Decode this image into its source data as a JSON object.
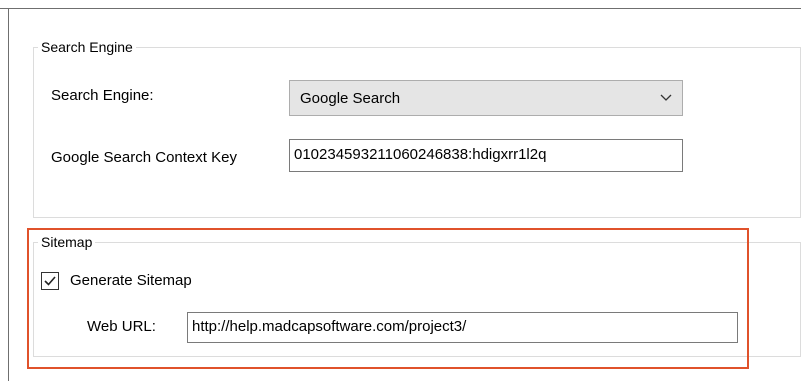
{
  "search_engine_group": {
    "legend": "Search Engine",
    "engine_label": "Search Engine:",
    "engine_value": "Google Search",
    "context_key_label": "Google Search Context Key",
    "context_key_value": "010234593211060246838:hdigxrr1l2q"
  },
  "sitemap_group": {
    "legend": "Sitemap",
    "generate_label": "Generate Sitemap",
    "generate_checked": true,
    "web_url_label": "Web URL:",
    "web_url_value": "http://help.madcapsoftware.com/project3/"
  },
  "colors": {
    "highlight": "#e0522b",
    "combo_bg": "#e5e5e5",
    "border": "#dcdcdc"
  },
  "icons": {
    "combo_arrow": "chevron-down-icon",
    "checkbox_mark": "checkmark-icon"
  }
}
